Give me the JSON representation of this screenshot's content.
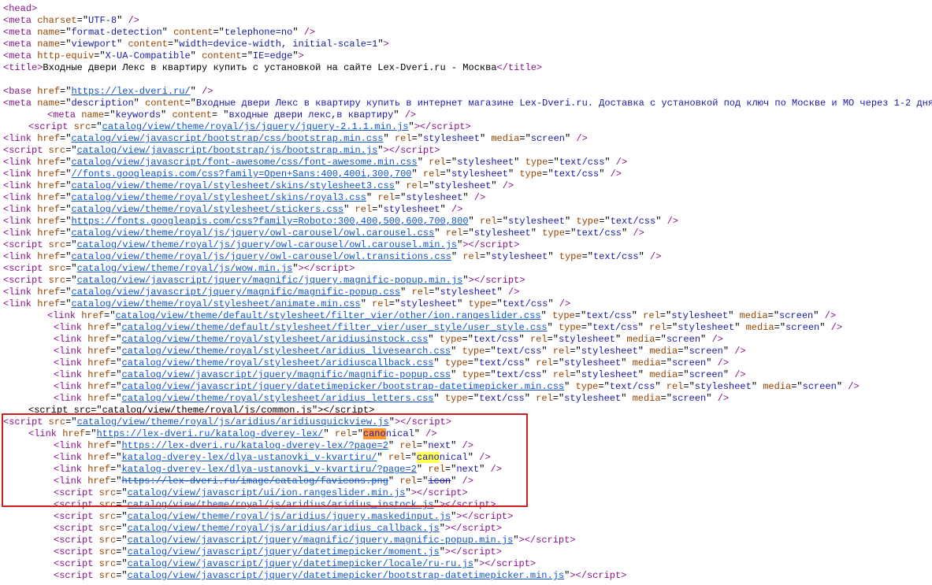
{
  "lines": [
    {
      "type": "tago",
      "indent": 0,
      "name": "head"
    },
    {
      "type": "tag",
      "indent": 0,
      "name": "meta",
      "attrs": [
        [
          "charset",
          "UTF-8"
        ]
      ]
    },
    {
      "type": "tag",
      "indent": 0,
      "name": "meta",
      "attrs": [
        [
          "name",
          "format-detection"
        ],
        [
          "content",
          "telephone=no"
        ]
      ]
    },
    {
      "type": "tag",
      "indent": 0,
      "name": "meta",
      "attrs": [
        [
          "name",
          "viewport"
        ],
        [
          "content",
          "width=device-width, initial-scale=1"
        ]
      ],
      "noclose": true
    },
    {
      "type": "tag",
      "indent": 0,
      "name": "meta",
      "attrs": [
        [
          "http-equiv",
          "X-UA-Compatible"
        ],
        [
          "content",
          "IE=edge"
        ]
      ],
      "noclose": true
    },
    {
      "type": "title",
      "indent": 0,
      "text": "Входные двери Лекс в квартиру купить с установкой на сайте Lex-Dveri.ru - Москва"
    },
    {
      "type": "blank"
    },
    {
      "type": "base",
      "indent": 0,
      "href": "https://lex-dveri.ru/"
    },
    {
      "type": "tag",
      "indent": 0,
      "name": "meta",
      "attrs": [
        [
          "name",
          "description"
        ],
        [
          "content",
          "Входные двери Лекс в квартиру купить в интернет магазине Lex-Dveri.ru. Доставка с установкой под ключ по Москве и МО через 1-2 дня"
        ]
      ],
      "noclose": true
    },
    {
      "type": "tag",
      "indent": 2,
      "name": "meta",
      "attrs": [
        [
          "name",
          "keywords"
        ],
        [
          "content",
          "входные двери лекс,в квартиру"
        ]
      ],
      "space_after_eq": true
    },
    {
      "type": "script",
      "indent": 1,
      "src": "catalog/view/theme/royal/js/jquery/jquery-2.1.1.min.js"
    },
    {
      "type": "link",
      "indent": 0,
      "order": "href-first",
      "href": "catalog/view/javascript/bootstrap/css/bootstrap.min.css",
      "rel": "stylesheet",
      "media": "screen"
    },
    {
      "type": "script",
      "indent": 0,
      "src": "catalog/view/javascript/bootstrap/js/bootstrap.min.js"
    },
    {
      "type": "link",
      "indent": 0,
      "order": "href-first",
      "href": "catalog/view/javascript/font-awesome/css/font-awesome.min.css",
      "rel": "stylesheet",
      "typecss": true
    },
    {
      "type": "link",
      "indent": 0,
      "order": "href-first",
      "href": "//fonts.googleapis.com/css?family=Open+Sans:400,400i,300,700",
      "rel": "stylesheet",
      "typecss": true
    },
    {
      "type": "link",
      "indent": 0,
      "order": "href-first",
      "href": "catalog/view/theme/royal/stylesheet/skins/stylesheet3.css",
      "rel": "stylesheet"
    },
    {
      "type": "link",
      "indent": 0,
      "order": "href-first",
      "href": "catalog/view/theme/royal/stylesheet/skins/royal3.css",
      "rel": "stylesheet"
    },
    {
      "type": "link",
      "indent": 0,
      "order": "href-first",
      "href": "catalog/view/theme/royal/stylesheet/stickers.css",
      "rel": "stylesheet"
    },
    {
      "type": "link",
      "indent": 0,
      "order": "href-first",
      "href": "https://fonts.googleapis.com/css?family=Roboto:300,400,500,600,700,800",
      "rel": "stylesheet",
      "typecss": true
    },
    {
      "type": "link",
      "indent": 0,
      "order": "href-first",
      "href": "catalog/view/theme/royal/js/jquery/owl-carousel/owl.carousel.css",
      "rel": "stylesheet",
      "typecss": true
    },
    {
      "type": "script",
      "indent": 0,
      "src": "catalog/view/theme/royal/js/jquery/owl-carousel/owl.carousel.min.js"
    },
    {
      "type": "link",
      "indent": 0,
      "order": "href-first",
      "href": "catalog/view/theme/royal/js/jquery/owl-carousel/owl.transitions.css",
      "rel": "stylesheet",
      "typecss": true
    },
    {
      "type": "script",
      "indent": 0,
      "src": "catalog/view/theme/royal/js/wow.min.js"
    },
    {
      "type": "script",
      "indent": 0,
      "src": "catalog/view/javascript/jquery/magnific/jquery.magnific-popup.min.js"
    },
    {
      "type": "link",
      "indent": 0,
      "order": "href-first",
      "href": "catalog/view/javascript/jquery/magnific/magnific-popup.css",
      "rel": "stylesheet"
    },
    {
      "type": "link",
      "indent": 0,
      "order": "href-first",
      "href": "catalog/view/theme/royal/stylesheet/animate.min.css",
      "rel": "stylesheet",
      "typecss": true
    },
    {
      "type": "link",
      "indent": 2,
      "order": "href-first",
      "href": "catalog/view/theme/default/stylesheet/filter_vier/other/ion.rangeslider.css",
      "typecss": true,
      "rel": "stylesheet",
      "media": "screen"
    },
    {
      "type": "link",
      "indent": 3,
      "order": "href-first",
      "href": "catalog/view/theme/default/stylesheet/filter_vier/user_style/user_style.css",
      "typecss": true,
      "rel": "stylesheet",
      "media": "screen"
    },
    {
      "type": "link",
      "indent": 3,
      "order": "href-first",
      "href": "catalog/view/theme/royal/stylesheet/aridiusinstock.css",
      "typecss": true,
      "rel": "stylesheet",
      "media": "screen"
    },
    {
      "type": "link",
      "indent": 3,
      "order": "href-first",
      "href": "catalog/view/theme/royal/stylesheet/aridius_livesearch.css",
      "typecss": true,
      "rel": "stylesheet",
      "media": "screen"
    },
    {
      "type": "link",
      "indent": 3,
      "order": "href-first",
      "href": "catalog/view/theme/royal/stylesheet/aridiuscallback.css",
      "typecss": true,
      "rel": "stylesheet",
      "media": "screen"
    },
    {
      "type": "link",
      "indent": 3,
      "order": "href-first",
      "href": "catalog/view/javascript/jquery/magnific/magnific-popup.css",
      "typecss": true,
      "rel": "stylesheet",
      "media": "screen"
    },
    {
      "type": "link",
      "indent": 3,
      "order": "href-first",
      "href": "catalog/view/javascript/jquery/datetimepicker/bootstrap-datetimepicker.min.css",
      "typecss": true,
      "rel": "stylesheet",
      "media": "screen"
    },
    {
      "type": "link",
      "indent": 3,
      "order": "href-first",
      "href": "catalog/view/theme/royal/stylesheet/aridius_letters.css",
      "typecss": true,
      "rel": "stylesheet",
      "media": "screen"
    },
    {
      "type": "script",
      "indent": 1,
      "src": "catalog/view/theme/royal/js/common.js",
      "plain": true
    },
    {
      "type": "script",
      "indent": 0,
      "src": "catalog/view/theme/royal/js/aridius/aridiusquickview.js"
    },
    {
      "type": "link_rel",
      "indent": 1,
      "href": "https://lex-dveri.ru/katalog-dverey-lex/",
      "rel": "canonical",
      "hi": "hi1"
    },
    {
      "type": "link_rel",
      "indent": 3,
      "href": "https://lex-dveri.ru/katalog-dverey-lex/?page=2",
      "rel": "next"
    },
    {
      "type": "link_rel",
      "indent": 3,
      "href": "katalog-dverey-lex/dlya-ustanovki_v-kvartiru/",
      "rel": "canonical",
      "hi": "hi2"
    },
    {
      "type": "link_rel",
      "indent": 3,
      "href": "katalog-dverey-lex/dlya-ustanovki_v-kvartiru/?page=2",
      "rel": "next"
    },
    {
      "type": "link_rel",
      "indent": 3,
      "href": "https://lex-dveri.ru/image/catalog/favicons.png",
      "rel": "icon",
      "strike": true
    },
    {
      "type": "script",
      "indent": 3,
      "src": "catalog/view/javascript/ui/ion.rangeslider.min.js"
    },
    {
      "type": "script",
      "indent": 3,
      "src": "catalog/view/theme/royal/js/aridius/aridius_instock.js"
    },
    {
      "type": "script",
      "indent": 3,
      "src": "catalog/view/theme/royal/js/aridius/jquery.maskedinput.js"
    },
    {
      "type": "script",
      "indent": 3,
      "src": "catalog/view/theme/royal/js/aridius/aridius_callback.js"
    },
    {
      "type": "script",
      "indent": 3,
      "src": "catalog/view/javascript/jquery/magnific/jquery.magnific-popup.min.js"
    },
    {
      "type": "script",
      "indent": 3,
      "src": "catalog/view/javascript/jquery/datetimepicker/moment.js"
    },
    {
      "type": "script",
      "indent": 3,
      "src": "catalog/view/javascript/jquery/datetimepicker/locale/ru-ru.js"
    },
    {
      "type": "script",
      "indent": 3,
      "src": "catalog/view/javascript/jquery/datetimepicker/bootstrap-datetimepicker.min.js"
    }
  ]
}
